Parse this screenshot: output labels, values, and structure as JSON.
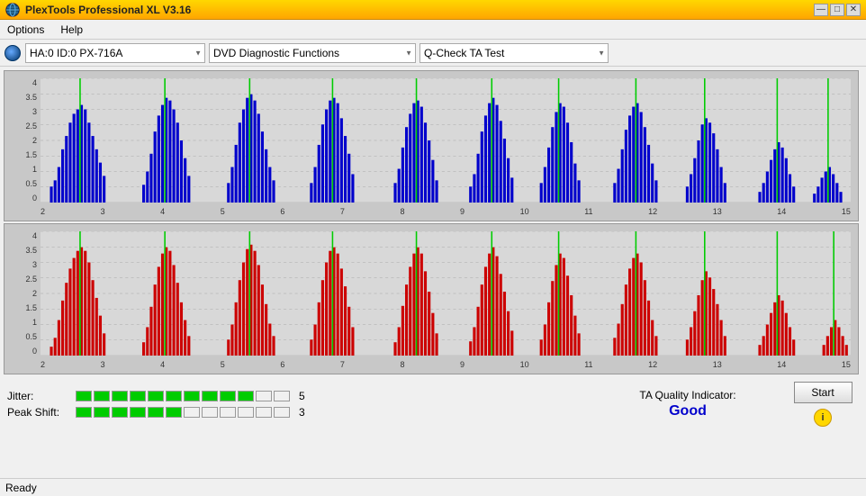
{
  "titleBar": {
    "title": "PlexTools Professional XL V3.16",
    "iconLabel": "P",
    "controls": [
      "—",
      "□",
      "✕"
    ]
  },
  "menuBar": {
    "items": [
      "Options",
      "Help"
    ]
  },
  "toolbar": {
    "deviceOptions": [
      "HA:0 ID:0  PX-716A"
    ],
    "functionOptions": [
      "DVD Diagnostic Functions"
    ],
    "testOptions": [
      "Q-Check TA Test"
    ]
  },
  "charts": {
    "topChart": {
      "yLabels": [
        "4",
        "3.5",
        "3",
        "2.5",
        "2",
        "1.5",
        "1",
        "0.5",
        "0"
      ],
      "xLabels": [
        "2",
        "3",
        "4",
        "5",
        "6",
        "7",
        "8",
        "9",
        "10",
        "11",
        "12",
        "13",
        "14",
        "15"
      ],
      "color": "blue"
    },
    "bottomChart": {
      "yLabels": [
        "4",
        "3.5",
        "3",
        "2.5",
        "2",
        "1.5",
        "1",
        "0.5",
        "0"
      ],
      "xLabels": [
        "2",
        "3",
        "4",
        "5",
        "6",
        "7",
        "8",
        "9",
        "10",
        "11",
        "12",
        "13",
        "14",
        "15"
      ],
      "color": "red"
    }
  },
  "metrics": {
    "jitter": {
      "label": "Jitter:",
      "filledCells": 10,
      "totalCells": 12,
      "value": "5"
    },
    "peakShift": {
      "label": "Peak Shift:",
      "filledCells": 6,
      "totalCells": 12,
      "value": "3"
    },
    "taQuality": {
      "label": "TA Quality Indicator:",
      "value": "Good"
    }
  },
  "buttons": {
    "start": "Start",
    "info": "i"
  },
  "statusBar": {
    "text": "Ready"
  }
}
